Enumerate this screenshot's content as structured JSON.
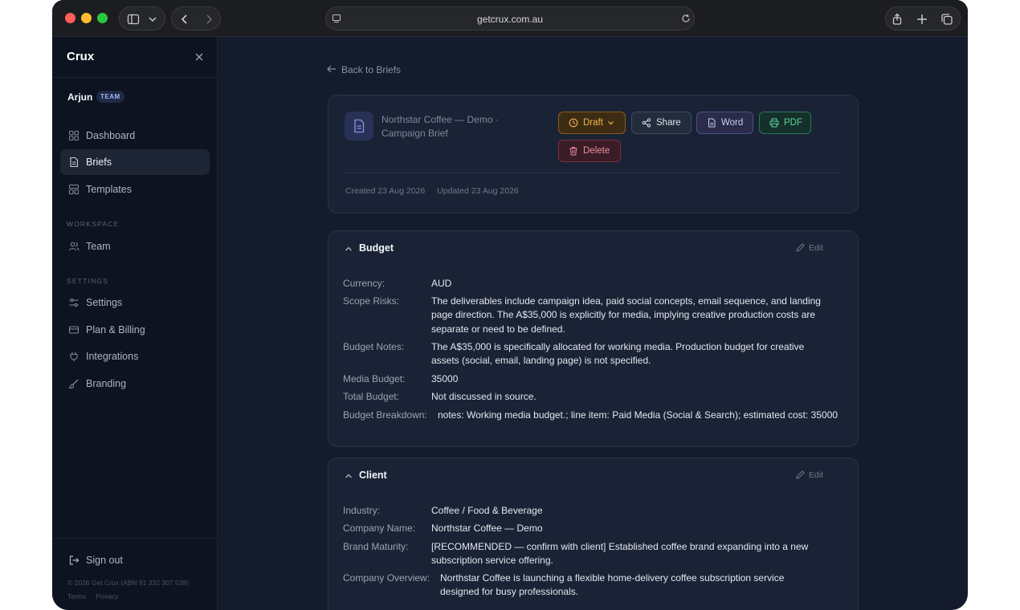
{
  "browser": {
    "url": "getcrux.com.au"
  },
  "sidebar": {
    "brand": "Crux",
    "user": {
      "name": "Arjun",
      "badge": "TEAM"
    },
    "items": [
      {
        "label": "Dashboard",
        "icon": "grid-icon"
      },
      {
        "label": "Briefs",
        "icon": "document-icon",
        "active": true
      },
      {
        "label": "Templates",
        "icon": "template-icon"
      }
    ],
    "workspace_label": "WORKSPACE",
    "workspace_items": [
      {
        "label": "Team",
        "icon": "users-icon"
      }
    ],
    "settings_label": "SETTINGS",
    "settings_items": [
      {
        "label": "Settings",
        "icon": "sliders-icon"
      },
      {
        "label": "Plan & Billing",
        "icon": "credit-card-icon"
      },
      {
        "label": "Integrations",
        "icon": "plug-icon"
      },
      {
        "label": "Branding",
        "icon": "brush-icon"
      }
    ],
    "sign_out": "Sign out",
    "copyright": "© 2026 Get Crux (ABN 91 332 307 539)",
    "terms": "Terms",
    "privacy": "Privacy"
  },
  "main": {
    "back_link": "Back to Briefs",
    "brief": {
      "title": "Northstar Coffee — Demo · Campaign Brief",
      "status": "Draft",
      "share": "Share",
      "word": "Word",
      "pdf": "PDF",
      "delete": "Delete",
      "created": "Created 23 Aug 2026",
      "updated": "Updated 23 Aug 2026"
    },
    "budget": {
      "title": "Budget",
      "edit": "Edit",
      "rows": [
        {
          "key": "Currency:",
          "value": "AUD"
        },
        {
          "key": "Scope Risks:",
          "value": "The deliverables include campaign idea, paid social concepts, email sequence, and landing page direction. The A$35,000 is explicitly for media, implying creative production costs are separate or need to be defined."
        },
        {
          "key": "Budget Notes:",
          "value": "The A$35,000 is specifically allocated for working media. Production budget for creative assets (social, email, landing page) is not specified."
        },
        {
          "key": "Media Budget:",
          "value": "35000"
        },
        {
          "key": "Total Budget:",
          "value": "Not discussed in source."
        },
        {
          "key": "Budget Breakdown:",
          "value": "notes: Working media budget.; line item: Paid Media (Social & Search); estimated cost: 35000"
        }
      ]
    },
    "client": {
      "title": "Client",
      "edit": "Edit",
      "rows": [
        {
          "key": "Industry:",
          "value": "Coffee / Food & Beverage"
        },
        {
          "key": "Company Name:",
          "value": "Northstar Coffee — Demo"
        },
        {
          "key": "Brand Maturity:",
          "value": "[RECOMMENDED — confirm with client] Established coffee brand expanding into a new subscription service offering."
        },
        {
          "key": "Company Overview:",
          "value": "Northstar Coffee is launching a flexible home-delivery coffee subscription service designed for busy professionals."
        }
      ]
    }
  }
}
